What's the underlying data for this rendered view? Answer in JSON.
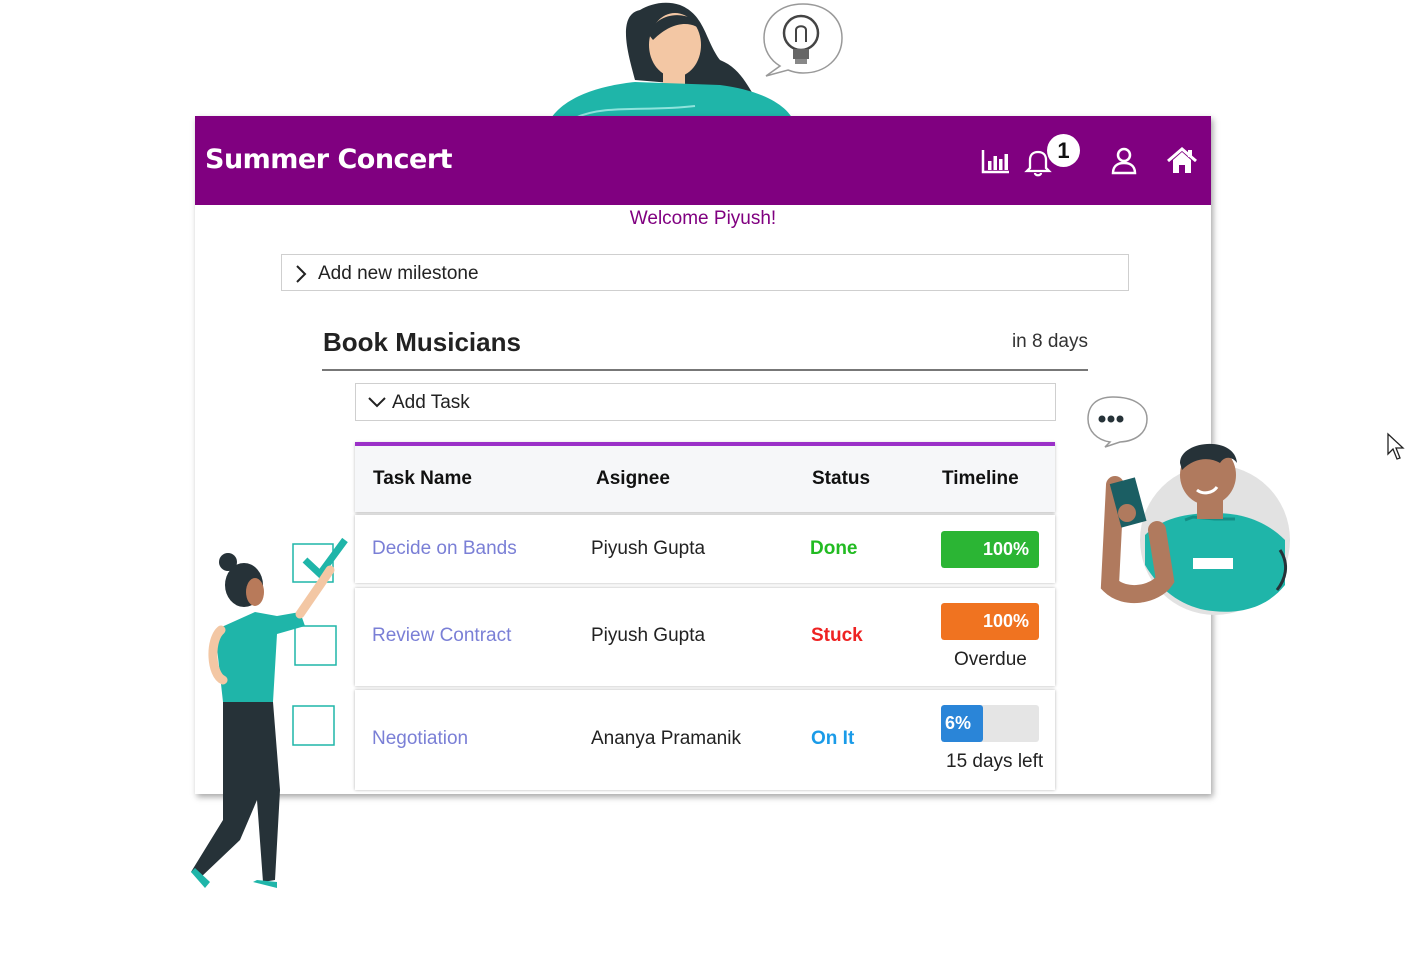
{
  "header": {
    "title": "Summer Concert",
    "notification_count": "1",
    "icons": [
      "chart-icon",
      "bell-icon",
      "user-icon",
      "home-icon"
    ]
  },
  "welcome": "Welcome Piyush!",
  "milestone_add": {
    "label": "Add new milestone"
  },
  "milestone": {
    "title": "Book Musicians",
    "due": "in 8 days",
    "add_task_label": "Add Task"
  },
  "table": {
    "headers": [
      "Task Name",
      "Asignee",
      "Status",
      "Timeline"
    ],
    "rows": [
      {
        "task": "Decide on Bands",
        "assignee": "Piyush Gupta",
        "status": "Done",
        "status_color": "#22bb22",
        "progress_label": "100%",
        "progress": 1.0,
        "bar_color": "#2bb534",
        "note": ""
      },
      {
        "task": "Review Contract",
        "assignee": "Piyush Gupta",
        "status": "Stuck",
        "status_color": "#ee2222",
        "progress_label": "100%",
        "progress": 1.0,
        "bar_color": "#f07320",
        "note": "Overdue"
      },
      {
        "task": "Negotiation",
        "assignee": "Ananya Pramanik",
        "status": "On It",
        "status_color": "#1a9be8",
        "progress_label": "6%",
        "progress": 0.06,
        "bar_color": "#2a85d8",
        "note": "15 days left"
      }
    ]
  },
  "colors": {
    "brand": "#800080",
    "accent": "#9b30c8",
    "teal": "#1fb5a9"
  }
}
